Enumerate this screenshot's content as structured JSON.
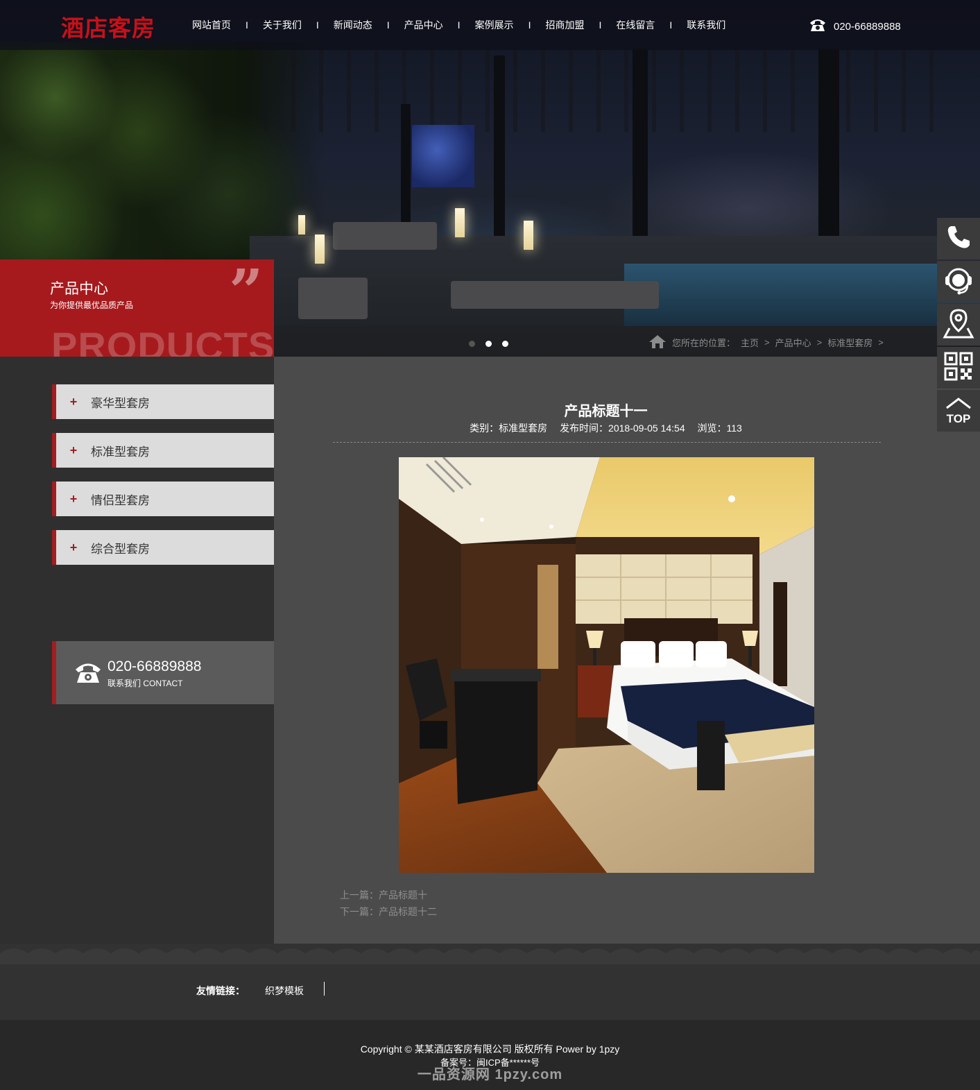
{
  "header": {
    "logo": "酒店客房",
    "nav": [
      "网站首页",
      "关于我们",
      "新闻动态",
      "产品中心",
      "案例展示",
      "招商加盟",
      "在线留言",
      "联系我们"
    ],
    "nav_separator": "I",
    "phone": "020-66889888"
  },
  "banner": {
    "title": "产品中心",
    "subtitle": "为你提供最优品质产品",
    "quote_mark": "”",
    "english": "PRODUCTS"
  },
  "slider": {
    "dots": 3,
    "active_dot": 1
  },
  "breadcrumb": {
    "prefix": "您所在的位置：",
    "items": [
      "主页",
      "产品中心",
      "标准型套房"
    ],
    "separator": ">"
  },
  "sidebar": {
    "items": [
      {
        "icon": "+",
        "label": "豪华型套房"
      },
      {
        "icon": "+",
        "label": "标准型套房"
      },
      {
        "icon": "+",
        "label": "情侣型套房"
      },
      {
        "icon": "+",
        "label": "综合型套房"
      }
    ],
    "contact": {
      "phone": "020-66889888",
      "label": "联系我们 CONTACT"
    }
  },
  "post": {
    "title": "产品标题十一",
    "category": "类别：标准型套房",
    "published": "发布时间：2018-09-05 14:54",
    "views": "浏览：113",
    "prev": "上一篇：产品标题十",
    "next": "下一篇：产品标题十二"
  },
  "footer": {
    "links_label": "友情链接：",
    "links": [
      "织梦模板"
    ],
    "copyright": "Copyright © 某某酒店客房有限公司 版权所有 Power by 1pzy",
    "icp": "备案号：闽ICP备******号",
    "watermark": "一品资源网 1pzy.com"
  },
  "float_bar": {
    "buttons": [
      "phone-icon",
      "customer-service-icon",
      "location-icon",
      "qrcode-icon",
      "top-icon"
    ],
    "top_label": "TOP"
  },
  "colors": {
    "accent": "#a61a1d",
    "logo": "#c8101a",
    "sidebar_item_bg": "#dcdcdc",
    "main_bg": "#4b4b4b"
  }
}
